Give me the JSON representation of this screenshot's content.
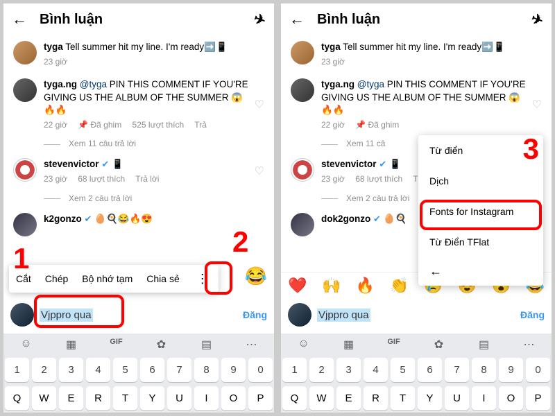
{
  "header": {
    "title": "Bình luận"
  },
  "comments": [
    {
      "user": "tyga",
      "text": " Tell summer hit my line. I'm ready➡️📱",
      "time": "23 giờ"
    },
    {
      "user": "tyga.ng",
      "tag": "@tyga",
      "text": " PIN THIS COMMENT IF YOU'RE GIVING US THE ALBUM OF THE SUMMER 😱🔥🔥",
      "time": "22 giờ",
      "pinned": "📌 Đã ghim",
      "likes": "525 lượt thích",
      "reply": "Trả ",
      "replies": "Xem 11 câu trả lời"
    },
    {
      "user": "stevenvictor",
      "text": " 📱",
      "time": "23 giờ",
      "likes": "68 lượt thích",
      "reply": "Trả lời",
      "replies": "Xem 2 câu trả lời"
    },
    {
      "user_cut": "k2gonzo",
      "user_full": "dok2gonzo"
    }
  ],
  "context_bar": {
    "cut": "Cắt",
    "copy": "Chép",
    "clipboard": "Bộ nhớ tạm",
    "share": "Chia sẻ"
  },
  "context_menu": {
    "dict": "Từ điển",
    "translate": "Dịch",
    "fonts": "Fonts for Instagram",
    "tflat": "Từ Điển TFlat"
  },
  "input": {
    "value": "Vjppro qua",
    "post": "Đăng"
  },
  "emojis": [
    "❤️",
    "🙌",
    "🔥",
    "👏",
    "😢",
    "😍",
    "😮",
    "😂"
  ],
  "kbd_tools": [
    "☺",
    "🔡",
    "GIF",
    "⚙",
    "📋",
    "⋯"
  ],
  "kbd_nums": [
    "1",
    "2",
    "3",
    "4",
    "5",
    "6",
    "7",
    "8",
    "9",
    "0"
  ],
  "kbd_row": [
    "Q",
    "W",
    "E",
    "R",
    "T",
    "Y",
    "U",
    "I",
    "O",
    "P"
  ],
  "steps": {
    "s1": "1",
    "s2": "2",
    "s3": "3"
  }
}
